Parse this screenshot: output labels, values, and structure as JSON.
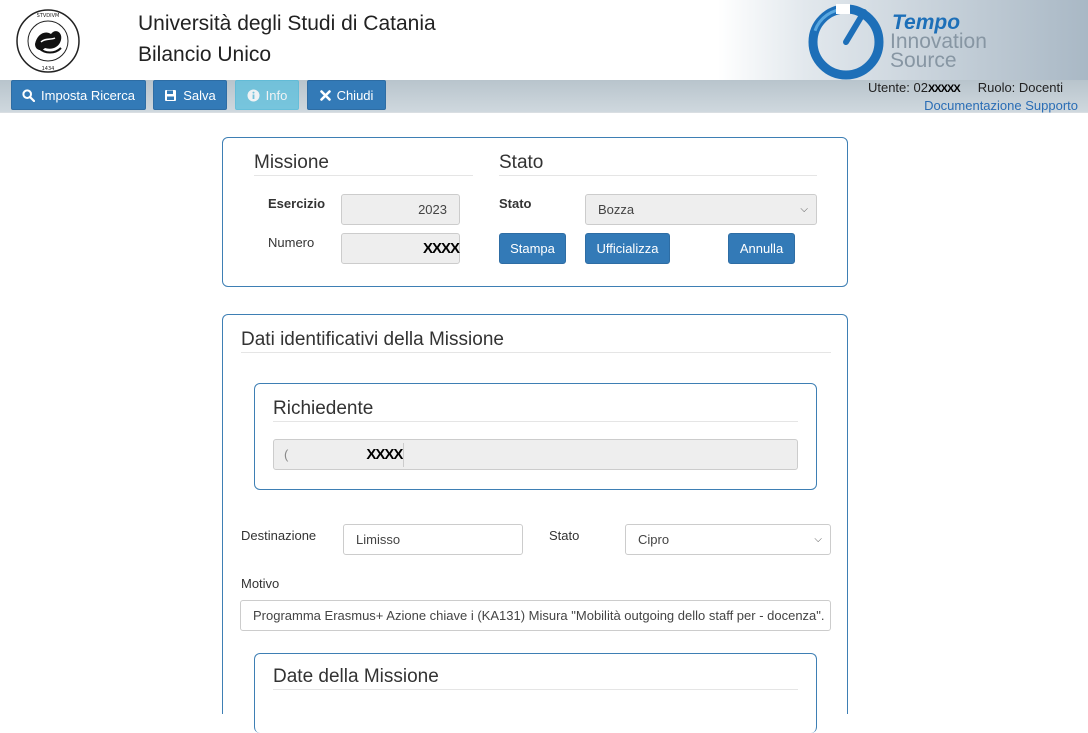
{
  "header": {
    "university": "Università degli Studi di Catania",
    "app": "Bilancio Unico",
    "seal_text": "SICILIAE STVDIVM GENERALE",
    "seal_year": "1434",
    "brand": {
      "line1": "Tempo",
      "line2": "Innovation",
      "line3": "Source"
    }
  },
  "toolbar": {
    "buttons": [
      {
        "label": "Imposta Ricerca",
        "icon": "search-icon"
      },
      {
        "label": "Salva",
        "icon": "save-icon"
      },
      {
        "label": "Info",
        "icon": "info-icon"
      },
      {
        "label": "Chiudi",
        "icon": "close-icon"
      }
    ],
    "user": "Utente: 02",
    "user_redacted": "XXXXX",
    "role": "Ruolo: Docenti",
    "links": "Documentazione Supporto"
  },
  "missione_panel": {
    "missione_title": "Missione",
    "stato_title": "Stato",
    "esercizio_label": "Esercizio",
    "esercizio_value": "2023",
    "numero_label": "Numero",
    "numero_value": "XXXX",
    "stato_label": "Stato",
    "stato_value": "Bozza",
    "stampa": "Stampa",
    "ufficializza": "Ufficializza",
    "annulla": "Annulla"
  },
  "dati_panel": {
    "title": "Dati identificativi della Missione",
    "richiedente_title": "Richiedente",
    "richiedente_prefix": "(",
    "richiedente_value": "XXXX",
    "destinazione_label": "Destinazione",
    "destinazione_value": "Limisso",
    "stato_label": "Stato",
    "stato_value": "Cipro",
    "motivo_label": "Motivo",
    "motivo_value": "Programma Erasmus+ Azione chiave i (KA131) Misura \"Mobilità outgoing dello staff per - docenza\".",
    "date_title": "Date della Missione"
  },
  "colors": {
    "primary": "#337ab7",
    "info": "#5bc0de",
    "panel_border": "#3e7fb4",
    "brand_blue": "#1d6fb8"
  }
}
